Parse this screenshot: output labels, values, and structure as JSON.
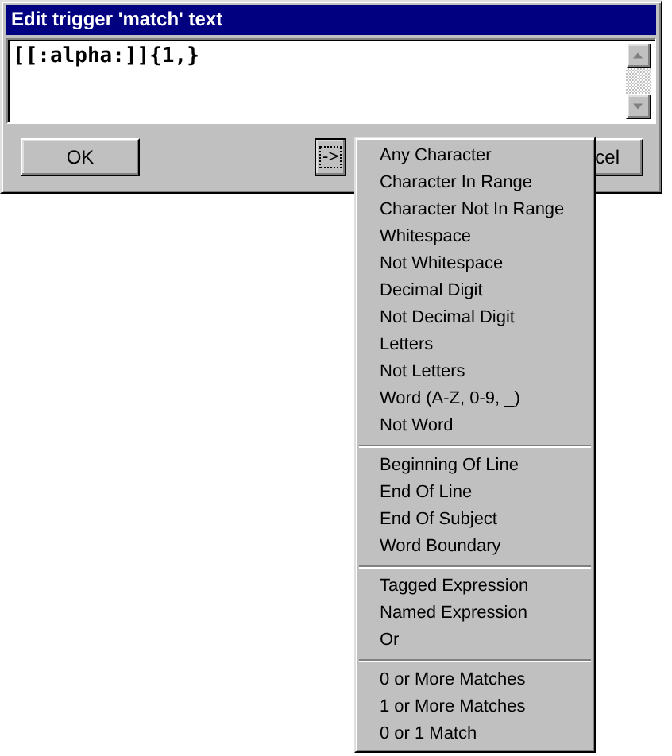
{
  "window": {
    "title": "Edit trigger 'match' text"
  },
  "editor": {
    "value": "[[:alpha:]]{1,}"
  },
  "buttons": [
    {
      "kind": "ok",
      "label": "OK"
    },
    {
      "kind": "insert",
      "label": "->"
    },
    {
      "kind": "cancel",
      "label": "cel"
    }
  ],
  "menu": {
    "groups": [
      [
        {
          "label": "Any Character"
        },
        {
          "label": "Character In Range"
        },
        {
          "label": "Character Not In Range"
        },
        {
          "label": "Whitespace"
        },
        {
          "label": "Not Whitespace"
        },
        {
          "label": "Decimal Digit"
        },
        {
          "label": "Not Decimal Digit"
        },
        {
          "label": "Letters"
        },
        {
          "label": "Not Letters"
        },
        {
          "label": "Word (A-Z, 0-9, _)"
        },
        {
          "label": "Not Word"
        }
      ],
      [
        {
          "label": "Beginning Of Line"
        },
        {
          "label": "End Of Line"
        },
        {
          "label": "End Of Subject"
        },
        {
          "label": "Word Boundary"
        }
      ],
      [
        {
          "label": "Tagged Expression"
        },
        {
          "label": "Named Expression"
        },
        {
          "label": "Or"
        }
      ],
      [
        {
          "label": "0 or More Matches"
        },
        {
          "label": "1 or More Matches"
        },
        {
          "label": "0 or 1 Match"
        }
      ]
    ]
  }
}
